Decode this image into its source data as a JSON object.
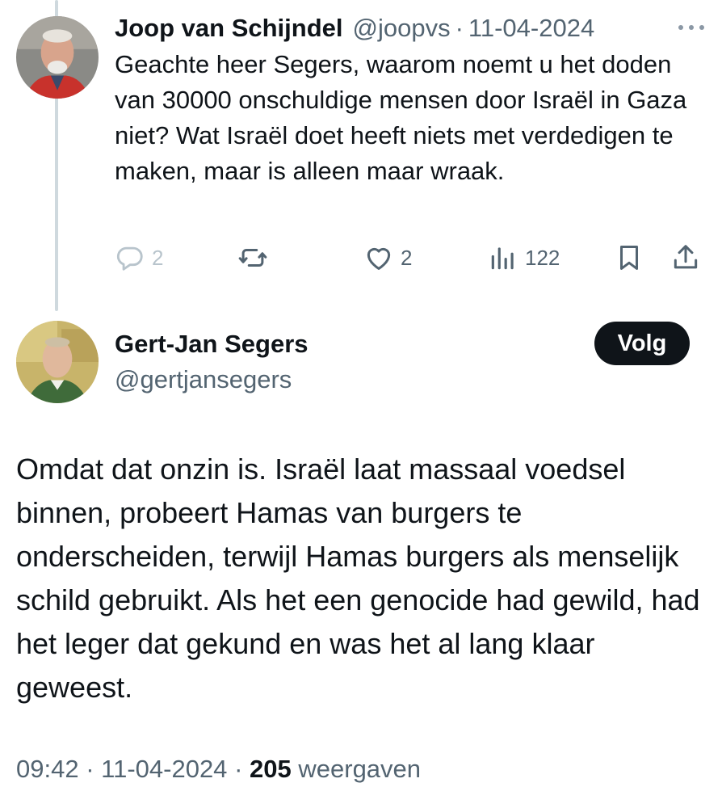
{
  "tweet1": {
    "author_name": "Joop van Schijndel",
    "author_handle": "@joopvs",
    "separator": "·",
    "date": "11-04-2024",
    "text": "Geachte heer Segers, waarom noemt u het doden van 30000 onschuldige mensen door Israël in Gaza niet? Wat Israël doet heeft niets met verdedigen te maken, maar is alleen maar wraak.",
    "more_icon": "more-horizontal-icon",
    "actions": {
      "reply_count": "2",
      "repost_count": "",
      "like_count": "2",
      "views_count": "122"
    }
  },
  "tweet2": {
    "author_name": "Gert-Jan Segers",
    "author_handle": "@gertjansegers",
    "follow_label": "Volg",
    "text": "Omdat dat onzin is. Israël laat massaal voedsel binnen, probeert Hamas van burgers te onderscheiden, terwijl Hamas burgers als menselijk schild gebruikt. Als het een genocide had gewild, had het leger dat gekund en was het al lang klaar geweest.",
    "meta": {
      "time": "09:42",
      "separator": "·",
      "date": "11-04-2024",
      "views_count": "205",
      "views_label": "weergaven"
    }
  },
  "colors": {
    "text": "#0f1419",
    "secondary": "#536471",
    "thread_line": "#cfd9de",
    "button_bg": "#0f1419"
  }
}
